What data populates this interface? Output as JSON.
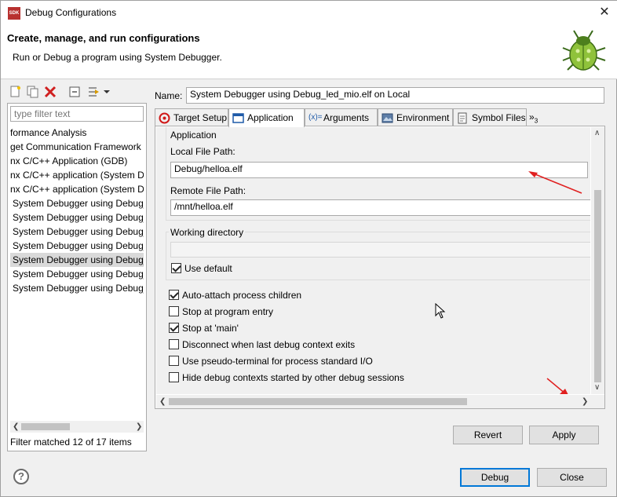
{
  "window": {
    "title": "Debug Configurations",
    "logo_text": "SDK"
  },
  "header": {
    "title": "Create, manage, and run configurations",
    "subtitle": "Run or Debug a program using System Debugger."
  },
  "left": {
    "filter_placeholder": "type filter text",
    "items": [
      "formance Analysis",
      "get Communication Framework",
      "nx C/C++ Application (GDB)",
      "nx C/C++ application (System D",
      "nx C/C++ application (System D",
      "System Debugger using Debug_",
      "System Debugger using Debug_",
      "System Debugger using Debug_",
      "System Debugger using Debug_",
      "System Debugger using Debug_",
      "System Debugger using Debug_",
      "System Debugger using Debug_"
    ],
    "selected_index": 9,
    "filter_status": "Filter matched 12 of 17 items"
  },
  "config": {
    "name_label": "Name:",
    "name_value": "System Debugger using Debug_led_mio.elf on Local"
  },
  "tabs": [
    {
      "label": "Target Setup",
      "icon": "target-icon"
    },
    {
      "label": "Application",
      "icon": "application-icon"
    },
    {
      "label": "Arguments",
      "icon": "arguments-icon"
    },
    {
      "label": "Environment",
      "icon": "environment-icon"
    },
    {
      "label": "Symbol Files",
      "icon": "symbol-files-icon"
    },
    {
      "label": "»",
      "sub": "3"
    }
  ],
  "application": {
    "group_label": "Application",
    "local_path_label": "Local File Path:",
    "local_path_value": "Debug/helloa.elf",
    "remote_path_label": "Remote File Path:",
    "remote_path_value": "/mnt/helloa.elf",
    "working_dir_label": "Working directory",
    "use_default_label": "Use default",
    "use_default_checked": true
  },
  "options": [
    {
      "label": "Auto-attach process children",
      "checked": true
    },
    {
      "label": "Stop at program entry",
      "checked": false
    },
    {
      "label": "Stop at 'main'",
      "checked": true
    },
    {
      "label": "Disconnect when last debug context exits",
      "checked": false
    },
    {
      "label": "Use pseudo-terminal for process standard I/O",
      "checked": false
    },
    {
      "label": "Hide debug contexts started by other debug sessions",
      "checked": false
    }
  ],
  "buttons": {
    "revert": "Revert",
    "apply": "Apply",
    "debug": "Debug",
    "close": "Close"
  },
  "help_glyph": "?",
  "colors": {
    "annotation_arrow": "#e02020",
    "default_button_border": "#0078d7",
    "selection": "#d9d9d9"
  }
}
